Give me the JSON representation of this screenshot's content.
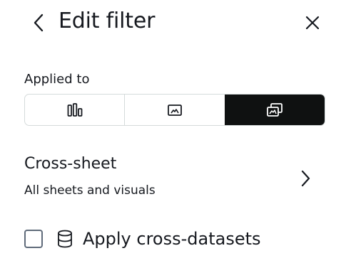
{
  "header": {
    "title": "Edit filter",
    "back_icon": "chevron-left-icon",
    "close_icon": "close-icon"
  },
  "applied_to": {
    "label": "Applied to",
    "options": [
      {
        "icon": "bar-chart-icon",
        "selected": false
      },
      {
        "icon": "visual-icon",
        "selected": false
      },
      {
        "icon": "multiple-visuals-icon",
        "selected": true
      }
    ],
    "selected_color": "#0f1111"
  },
  "cross_sheet": {
    "title": "Cross-sheet",
    "subtitle": "All sheets and visuals",
    "icon": "chevron-right-icon"
  },
  "cross_datasets": {
    "label": "Apply cross-datasets",
    "checked": false,
    "icon": "database-icon"
  }
}
